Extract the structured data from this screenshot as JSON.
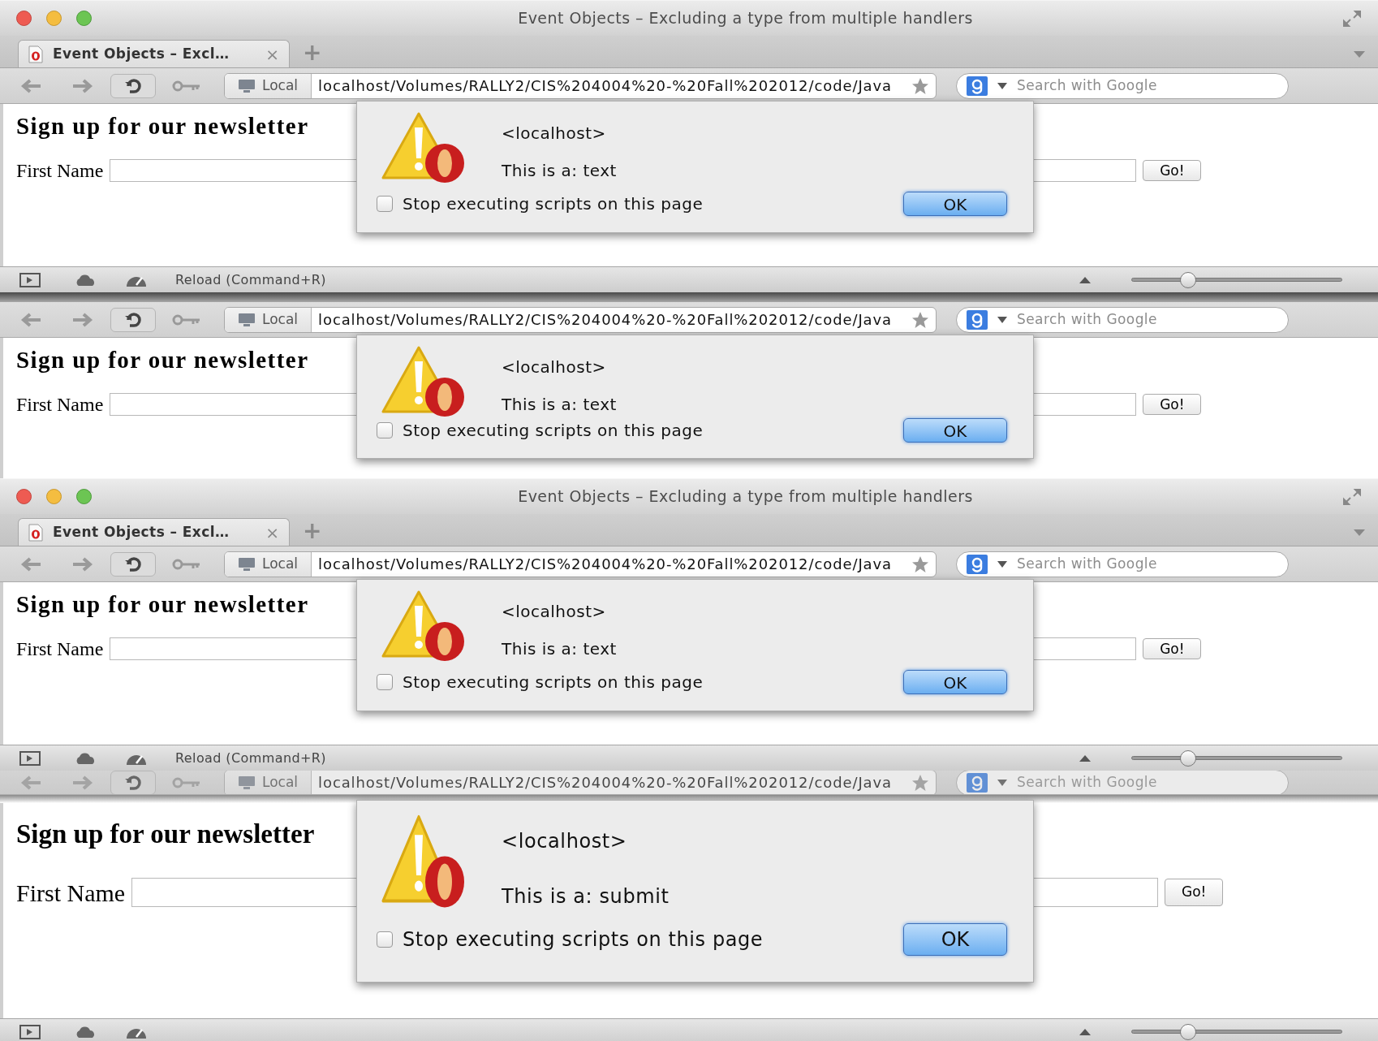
{
  "panels": [
    {
      "kind": "window",
      "title": "Event Objects – Excluding a type from multiple handlers",
      "tab": {
        "label": "Event Objects – Excl…",
        "close": "×",
        "selected": true
      },
      "new_tab": "+",
      "toolbar": {
        "location_label": "Local",
        "url": "localhost/Volumes/RALLY2/CIS%204004%20-%20Fall%202012/code/Java",
        "search_placeholder": "Search with Google"
      },
      "page": {
        "heading": "Sign up for our newsletter",
        "first_name_label": "First Name",
        "go_button": "Go!"
      },
      "dialog": {
        "origin": "<localhost>",
        "message": "This is a: text",
        "checkbox_label": "Stop executing scripts on this page",
        "checked": false,
        "ok_button": "OK"
      },
      "status_bar": {
        "text": "Reload (Command+R)",
        "zoom": {
          "level": 0.27
        }
      }
    },
    {
      "kind": "fragment",
      "toolbar": {
        "location_label": "Local",
        "url": "localhost/Volumes/RALLY2/CIS%204004%20-%20Fall%202012/code/Java",
        "search_placeholder": "Search with Google"
      },
      "page": {
        "heading": "Sign up for our newsletter",
        "first_name_label": "First Name",
        "go_button": "Go!"
      },
      "dialog": {
        "origin": "<localhost>",
        "message": "This is a: text",
        "checkbox_label": "Stop executing scripts on this page",
        "checked": false,
        "ok_button": "OK"
      }
    },
    {
      "kind": "window",
      "title": "Event Objects – Excluding a type from multiple handlers",
      "tab": {
        "label": "Event Objects – Excl…",
        "close": "×",
        "selected": true
      },
      "new_tab": "+",
      "toolbar": {
        "location_label": "Local",
        "url": "localhost/Volumes/RALLY2/CIS%204004%20-%20Fall%202012/code/Java",
        "search_placeholder": "Search with Google"
      },
      "page": {
        "heading": "Sign up for our newsletter",
        "first_name_label": "First Name",
        "go_button": "Go!"
      },
      "dialog": {
        "origin": "<localhost>",
        "message": "This is a: text",
        "checkbox_label": "Stop executing scripts on this page",
        "checked": false,
        "ok_button": "OK"
      },
      "status_bar": {
        "text": "Reload (Command+R)",
        "zoom": {
          "level": 0.27
        }
      }
    },
    {
      "kind": "large_fragment",
      "toolbar": {
        "location_label": "Local",
        "url": "localhost/Volumes/RALLY2/CIS%204004%20-%20Fall%202012/code/Java",
        "search_placeholder": "Search with Google"
      },
      "page": {
        "heading": "Sign up for our newsletter",
        "first_name_label": "First Name",
        "go_button": "Go!"
      },
      "dialog": {
        "origin": "<localhost>",
        "message": "This is a: submit",
        "checkbox_label": "Stop executing scripts on this page",
        "checked": false,
        "ok_button": "OK"
      },
      "status_bar": {
        "zoom": {
          "level": 0.27
        }
      }
    }
  ]
}
